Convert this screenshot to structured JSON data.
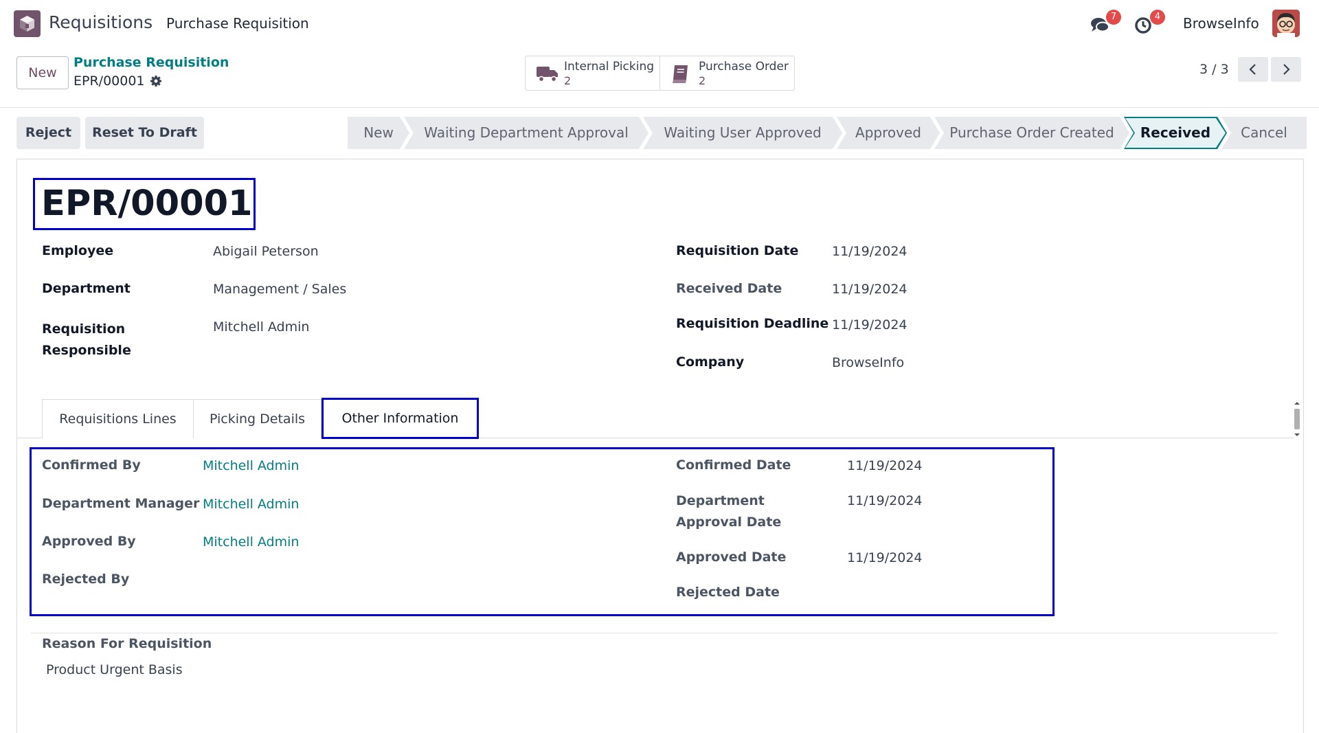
{
  "topnav": {
    "app_name": "Requisitions",
    "menu_item": "Purchase Requisition",
    "messages_count": "7",
    "activities_count": "4",
    "company": "BrowseInfo"
  },
  "control_panel": {
    "new_button": "New",
    "breadcrumb_parent": "Purchase Requisition",
    "breadcrumb_current": "EPR/00001",
    "smart_buttons": [
      {
        "label": "Internal Picking",
        "value": "2",
        "icon": "truck-icon"
      },
      {
        "label": "Purchase Order",
        "value": "2",
        "icon": "book-icon"
      }
    ],
    "pager": "3 / 3"
  },
  "actions": {
    "reject": "Reject",
    "reset_to_draft": "Reset To Draft"
  },
  "statusbar": {
    "stages": [
      "New",
      "Waiting Department Approval",
      "Waiting User Approved",
      "Approved",
      "Purchase Order Created",
      "Received",
      "Cancel"
    ],
    "active": "Received"
  },
  "record": {
    "title": "EPR/00001",
    "left_fields": [
      {
        "label": "Employee",
        "value": "Abigail Peterson"
      },
      {
        "label": "Department",
        "value": "Management / Sales"
      },
      {
        "label": "Requisition Responsible",
        "value": "Mitchell Admin"
      }
    ],
    "right_fields": [
      {
        "label": "Requisition Date",
        "value": "11/19/2024"
      },
      {
        "label": "Received Date",
        "value": "11/19/2024"
      },
      {
        "label": "Requisition Deadline",
        "value": "11/19/2024"
      },
      {
        "label": "Company",
        "value": "BrowseInfo"
      }
    ]
  },
  "tabs": [
    "Requisitions Lines",
    "Picking Details",
    "Other Information"
  ],
  "active_tab": "Other Information",
  "other_info": {
    "left": [
      {
        "label": "Confirmed By",
        "value": "Mitchell Admin"
      },
      {
        "label": "Department Manager",
        "value": "Mitchell Admin"
      },
      {
        "label": "Approved By",
        "value": "Mitchell Admin"
      },
      {
        "label": "Rejected By",
        "value": ""
      }
    ],
    "right": [
      {
        "label": "Confirmed Date",
        "value": "11/19/2024"
      },
      {
        "label": "Department Approval Date",
        "value": "11/19/2024"
      },
      {
        "label": "Approved Date",
        "value": "11/19/2024"
      },
      {
        "label": "Rejected Date",
        "value": ""
      }
    ]
  },
  "reason": {
    "label": "Reason For Requisition",
    "value": "Product Urgent Basis"
  },
  "colors": {
    "brand": "#714b67",
    "link": "#017e84",
    "highlight": "#0000cc",
    "badge": "#e34a4a"
  }
}
